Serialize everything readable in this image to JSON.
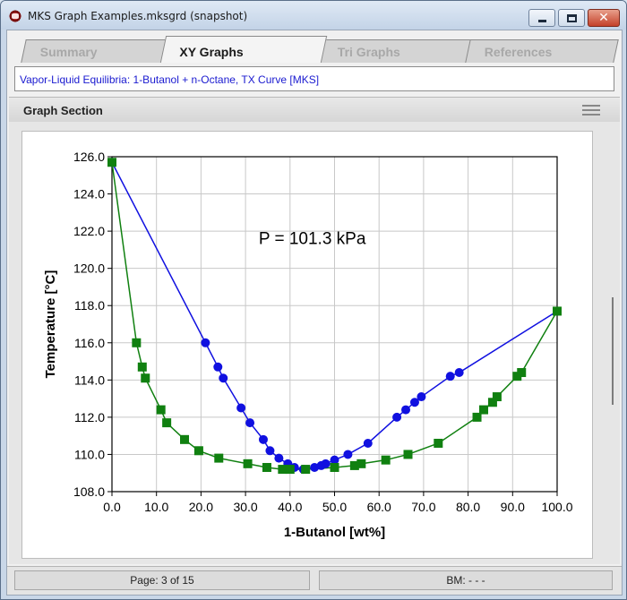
{
  "window": {
    "title": "MKS Graph Examples.mksgrd (snapshot)",
    "close_glyph": "✕"
  },
  "tabs": [
    {
      "label": "Summary",
      "active": false
    },
    {
      "label": "XY Graphs",
      "active": true
    },
    {
      "label": "Tri Graphs",
      "active": false
    },
    {
      "label": "References",
      "active": false
    }
  ],
  "subject": "Vapor-Liquid Equilibria: 1-Butanol + n-Octane, TX Curve [MKS]",
  "section": {
    "title": "Graph Section",
    "menu_icon": "hamburger-menu-icon"
  },
  "status": {
    "page": "Page: 3 of 15",
    "bm": "BM: - - -"
  },
  "colors": {
    "vapor": "#1010e0",
    "liquid": "#108010",
    "grid": "#c8c8c8"
  },
  "chart_data": {
    "type": "scatter",
    "annotation": "P = 101.3 kPa",
    "xlabel": "1-Butanol [wt%]",
    "ylabel": "Temperature [°C]",
    "xlim": [
      0,
      100
    ],
    "ylim": [
      108,
      126
    ],
    "xticks": [
      "0.0",
      "10.0",
      "20.0",
      "30.0",
      "40.0",
      "50.0",
      "60.0",
      "70.0",
      "80.0",
      "90.0",
      "100.0"
    ],
    "yticks": [
      "108.0",
      "110.0",
      "112.0",
      "114.0",
      "116.0",
      "118.0",
      "120.0",
      "122.0",
      "124.0",
      "126.0"
    ],
    "grid": true,
    "series": [
      {
        "marker": "circle",
        "color": "#1010e0",
        "points": [
          [
            0,
            125.7
          ],
          [
            21,
            116
          ],
          [
            23.8,
            114.7
          ],
          [
            25,
            114.1
          ],
          [
            29,
            112.5
          ],
          [
            31,
            111.7
          ],
          [
            34,
            110.8
          ],
          [
            35.5,
            110.2
          ],
          [
            37.5,
            109.8
          ],
          [
            39.5,
            109.5
          ],
          [
            41,
            109.3
          ],
          [
            43,
            109.2
          ],
          [
            45.5,
            109.3
          ],
          [
            47,
            109.4
          ],
          [
            48,
            109.5
          ],
          [
            50,
            109.7
          ],
          [
            53,
            110
          ],
          [
            57.5,
            110.6
          ],
          [
            64,
            112
          ],
          [
            66,
            112.4
          ],
          [
            68,
            112.8
          ],
          [
            69.5,
            113.1
          ],
          [
            76,
            114.2
          ],
          [
            78,
            114.4
          ],
          [
            100,
            117.7
          ]
        ]
      },
      {
        "marker": "square",
        "color": "#108010",
        "points": [
          [
            0,
            125.7
          ],
          [
            5.5,
            116
          ],
          [
            6.8,
            114.7
          ],
          [
            7.5,
            114.1
          ],
          [
            11,
            112.4
          ],
          [
            12.3,
            111.7
          ],
          [
            16.3,
            110.8
          ],
          [
            19.5,
            110.2
          ],
          [
            24,
            109.8
          ],
          [
            30.5,
            109.5
          ],
          [
            34.8,
            109.3
          ],
          [
            38.3,
            109.2
          ],
          [
            40,
            109.2
          ],
          [
            43.5,
            109.2
          ],
          [
            50,
            109.3
          ],
          [
            54.5,
            109.4
          ],
          [
            56,
            109.5
          ],
          [
            61.5,
            109.7
          ],
          [
            66.5,
            110
          ],
          [
            73.3,
            110.6
          ],
          [
            82,
            112
          ],
          [
            83.5,
            112.4
          ],
          [
            85.5,
            112.8
          ],
          [
            86.5,
            113.1
          ],
          [
            91,
            114.2
          ],
          [
            92,
            114.4
          ],
          [
            100,
            117.7
          ]
        ]
      }
    ]
  }
}
